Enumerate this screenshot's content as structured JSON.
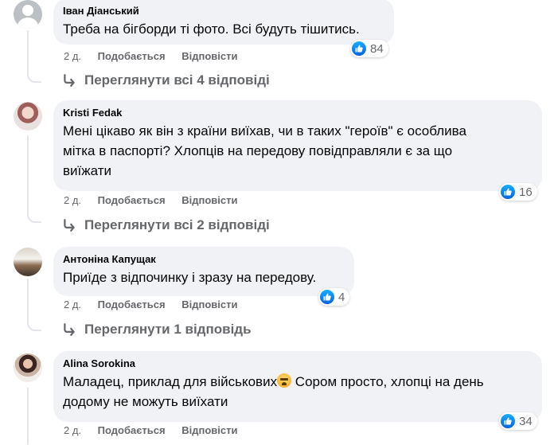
{
  "comments": [
    {
      "author": "Іван Діанський",
      "text": "Треба на бігборди ті фото. Всі будуть тішитись.",
      "time": "2 д.",
      "like_label": "Подобається",
      "reply_label": "Відповісти",
      "reactions": "84",
      "view_replies": "Переглянути всі 4 відповіді"
    },
    {
      "author": "Kristi Fedak",
      "text_lines": [
        "Мені цікаво як він з країни виїхав, чи в таких \"героїв\" є особлива",
        "мітка в паспорті? Хлопців на передову повідправляли є за що",
        "виїжати"
      ],
      "time": "2 д.",
      "like_label": "Подобається",
      "reply_label": "Відповісти",
      "reactions": "16",
      "view_replies": "Переглянути всі 2 відповіді"
    },
    {
      "author": "Антоніна Капущак",
      "text": "Приїде з відпочинку і зразу на передову.",
      "time": "2 д.",
      "like_label": "Подобається",
      "reply_label": "Відповісти",
      "reactions": "4",
      "view_replies": "Переглянути 1 відповідь"
    },
    {
      "author": "Alina Sorokina",
      "text_part1": "Маладец, приклад для військових",
      "emoji": "anxious-face-emoji",
      "text_part2": " Сором просто, хлопці на день",
      "text_line2": "додому не можуть виїхати",
      "time": "2 д.",
      "like_label": "Подобається",
      "reply_label": "Відповісти",
      "reactions": "34"
    }
  ],
  "colors": {
    "bubble": "#f0f2f5",
    "secondary_text": "#65676b",
    "like_blue": "#0866ff"
  }
}
